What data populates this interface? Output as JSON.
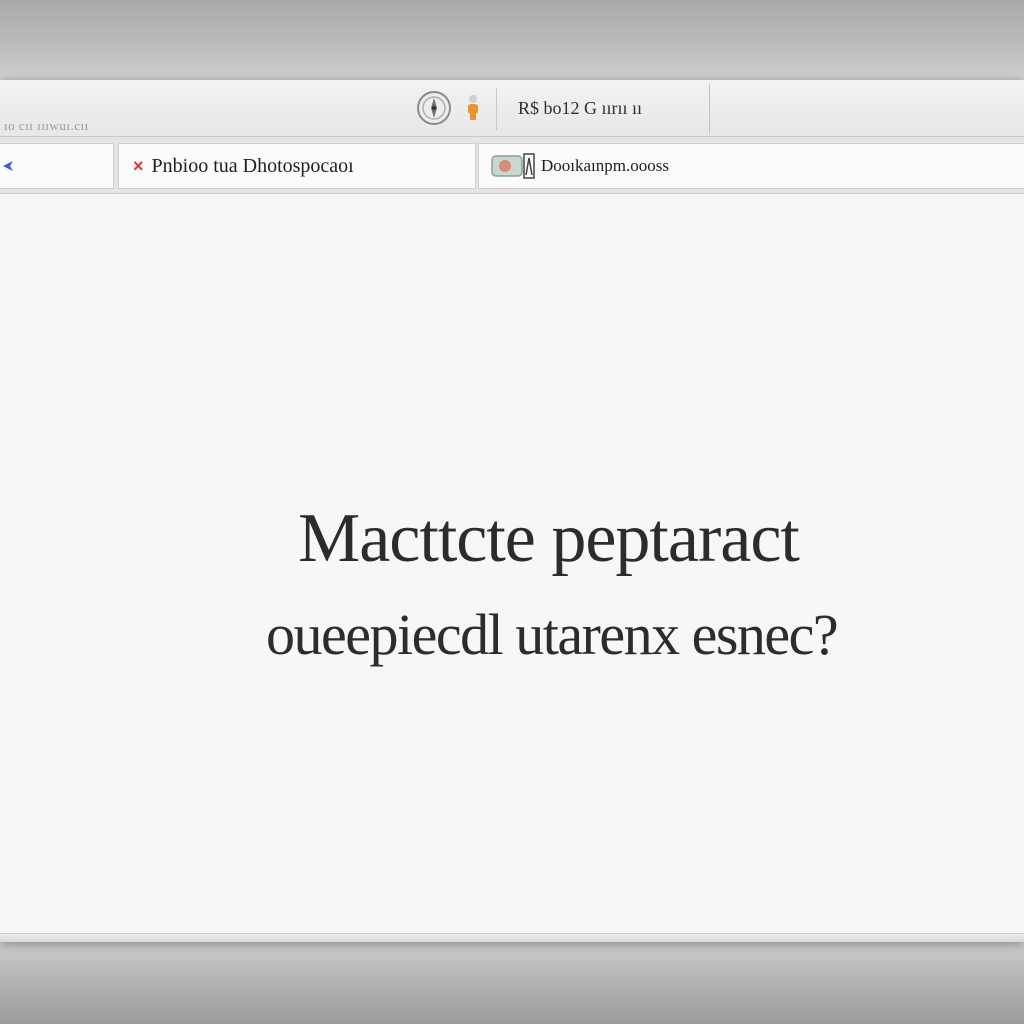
{
  "window": {
    "title": "ıo cıı ıııwuı.cıı"
  },
  "toolbar": {
    "address_text": "R$ bo12 G ıırıı ıı",
    "safari_icon": "safari-compass-icon",
    "user_icon": "user-figure-icon"
  },
  "tabs": [
    {
      "label": "",
      "icon": "back-arrow-icon"
    },
    {
      "label": "Pnbioo tua Dhotospocaoı",
      "icon": "close-x-icon"
    },
    {
      "label": "Dooıkaınpm.oooss",
      "icon": "site-favicon-icon"
    }
  ],
  "content": {
    "headline": "Macttcte peptaract",
    "subline": "oueepiecdl utarenx esnec?"
  },
  "colors": {
    "accent_blue": "#3a5bd6",
    "close_red": "#d23a36",
    "user_icon_orange": "#e8972e",
    "text_dark": "#2c2c2c"
  }
}
